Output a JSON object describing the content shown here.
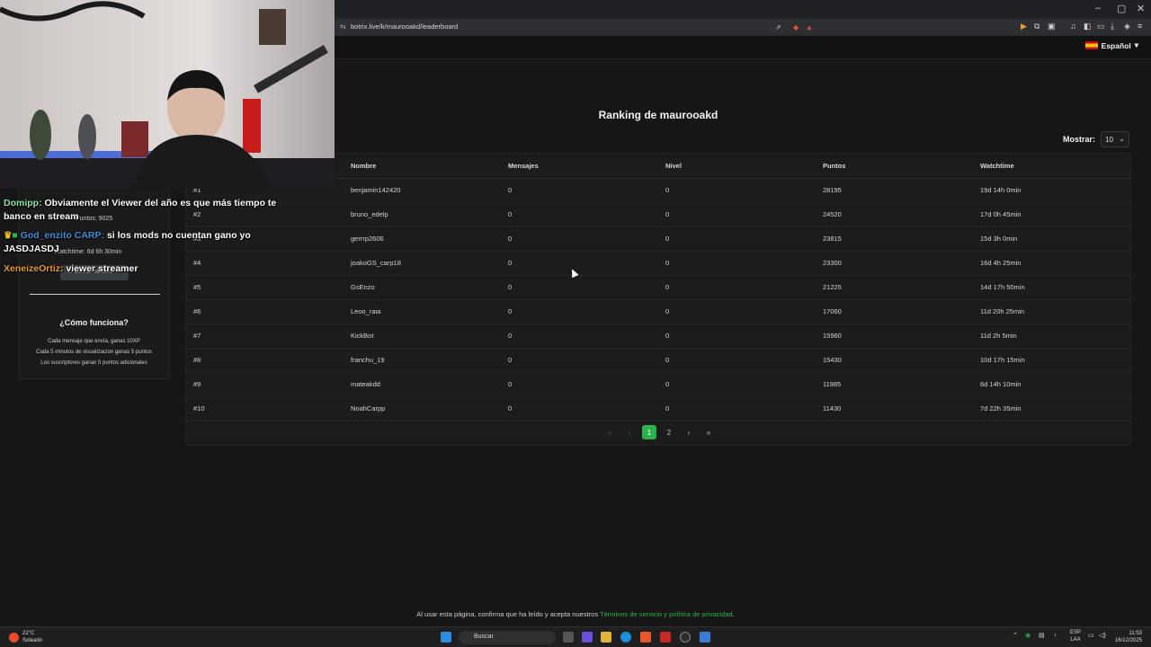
{
  "browser": {
    "url": "botrix.live/k/maurooakd/leaderboard",
    "window_controls": [
      "–",
      "▢",
      "✕"
    ]
  },
  "header": {
    "language": "Español"
  },
  "page": {
    "title": "Ranking de maurooakd",
    "show_label": "Mostrar:",
    "show_value": "10"
  },
  "table": {
    "columns": [
      "",
      "Nombre",
      "Mensajes",
      "Nivel",
      "Puntos",
      "Watchtime"
    ],
    "rows": [
      {
        "rank": "#1",
        "name": "benjamin142420",
        "messages": "0",
        "level": "0",
        "points": "28195",
        "watchtime": "19d 14h 0min"
      },
      {
        "rank": "#2",
        "name": "bruno_edelp",
        "messages": "0",
        "level": "0",
        "points": "24520",
        "watchtime": "17d 0h 45min"
      },
      {
        "rank": "#3",
        "name": "gerrrp2606",
        "messages": "0",
        "level": "0",
        "points": "23815",
        "watchtime": "15d 3h 0min"
      },
      {
        "rank": "#4",
        "name": "joakoGS_carp18",
        "messages": "0",
        "level": "0",
        "points": "23300",
        "watchtime": "16d 4h 25min"
      },
      {
        "rank": "#5",
        "name": "GsEnzo",
        "messages": "0",
        "level": "0",
        "points": "21225",
        "watchtime": "14d 17h 50min"
      },
      {
        "rank": "#6",
        "name": "Leoo_raia",
        "messages": "0",
        "level": "0",
        "points": "17060",
        "watchtime": "11d 20h 25min"
      },
      {
        "rank": "#7",
        "name": "KickBot",
        "messages": "0",
        "level": "0",
        "points": "15960",
        "watchtime": "11d 2h 5min"
      },
      {
        "rank": "#8",
        "name": "franchu_19",
        "messages": "0",
        "level": "0",
        "points": "15430",
        "watchtime": "10d 17h 15min"
      },
      {
        "rank": "#9",
        "name": "mateakdd",
        "messages": "0",
        "level": "0",
        "points": "11985",
        "watchtime": "6d 14h 10min"
      },
      {
        "rank": "#10",
        "name": "NoahCarpp",
        "messages": "0",
        "level": "0",
        "points": "11430",
        "watchtime": "7d 22h 35min"
      }
    ]
  },
  "pagination": {
    "first": "«",
    "prev": "‹",
    "pages": [
      "1",
      "2"
    ],
    "active_page": "1",
    "next": "›",
    "last": "»"
  },
  "sidebar": {
    "points_text": "Puntos: 9025",
    "watchtime_text": "Watchtime: 6d 6h 30min",
    "logout_label": "Cerrar sesión",
    "how_title": "¿Cómo funciona?",
    "how_lines": [
      "Cada mensaje que envía, ganas 10XP",
      "Cada 5 minutos de visualizacion ganas 5 puntos",
      "Los suscriptores ganan 5 puntos adicionales"
    ]
  },
  "chat": [
    {
      "user": "Domipp:",
      "text": "Obviamente el Viewer del año es que más tiempo te",
      "text2": "banco en stream"
    },
    {
      "user": "God_enzito CARP:",
      "text": "si los mods no cuentan gano yo",
      "text2": "JASDJASDJ"
    },
    {
      "user": "XeneizeOrtiz:",
      "text": "viewer streamer"
    }
  ],
  "footer": {
    "text": "Al usar esta página, confirma que ha leído y acepta nuestros ",
    "link": "Términos de servicio y política de privacidad",
    "end": "."
  },
  "taskbar": {
    "temp": "22°C",
    "weather": "Soleado",
    "search": "Buscar",
    "lang1": "ESP",
    "lang2": "LAA",
    "time": "11:53",
    "date": "16/12/2025"
  },
  "colors": {
    "accent": "#2bb24c",
    "background": "#161616"
  }
}
